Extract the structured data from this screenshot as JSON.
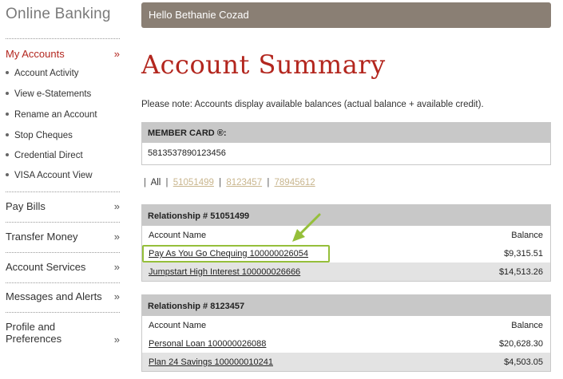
{
  "sidebar": {
    "brand": "Online Banking",
    "my_accounts": "My Accounts",
    "sub_items": [
      "Account Activity",
      "View e-Statements",
      "Rename an Account",
      "Stop Cheques",
      "Credential Direct",
      "VISA Account View"
    ],
    "pay_bills": "Pay Bills",
    "transfer_money": "Transfer Money",
    "account_services": "Account Services",
    "messages_alerts": "Messages and Alerts",
    "profile_line1": "Profile and",
    "profile_line2": "Preferences",
    "chevron": "»"
  },
  "header": {
    "greeting": "Hello Bethanie Cozad"
  },
  "main": {
    "title": "Account Summary",
    "note": "Please note: Accounts display available balances (actual balance + available credit).",
    "member_card": {
      "label": "MEMBER CARD ®:",
      "number": "5813537890123456"
    },
    "filter": {
      "all": "All",
      "links": [
        "51051499",
        "8123457",
        "78945612"
      ]
    },
    "relationships": [
      {
        "title": "Relationship # 51051499",
        "col_name": "Account Name",
        "col_balance": "Balance",
        "accounts": [
          {
            "name": "Pay As You Go Chequing 100000026054",
            "balance": "$9,315.51"
          },
          {
            "name": "Jumpstart High Interest 100000026666",
            "balance": "$14,513.26"
          }
        ]
      },
      {
        "title": "Relationship # 8123457",
        "col_name": "Account Name",
        "col_balance": "Balance",
        "accounts": [
          {
            "name": "Personal Loan 100000026088",
            "balance": "$20,628.30"
          },
          {
            "name": "Plan 24 Savings 100000010241",
            "balance": "$4,503.05"
          }
        ]
      }
    ]
  },
  "colors": {
    "accent_red": "#b3261e",
    "header_bar": "#8a7f74",
    "highlight_green": "#95bf3a",
    "link_tan": "#c9b68e"
  }
}
